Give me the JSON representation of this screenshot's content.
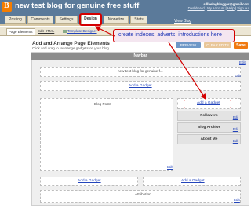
{
  "header": {
    "title": "new test blog for genuine free stuff",
    "email": "sillbeloghlogger@gmail.com",
    "links": [
      "Dashboard",
      "My Account",
      "Help",
      "Sign out"
    ]
  },
  "tabs": [
    {
      "label": "Posting"
    },
    {
      "label": "Comments"
    },
    {
      "label": "Settings"
    },
    {
      "label": "Design"
    },
    {
      "label": "Monetize"
    },
    {
      "label": "Stats"
    }
  ],
  "view_blog": "View Blog",
  "subtabs": {
    "page_elements": "Page Elements",
    "edit_html": "Edit HTML",
    "template_designer": "Template Designer"
  },
  "content": {
    "title": "Add and Arrange Page Elements",
    "subtitle": "Click and drag to rearrange gadgets on your blog.",
    "preview": "PREVIEW",
    "clear": "CLEAR EDITS",
    "save": "Save"
  },
  "layout": {
    "navbar": "Navbar",
    "header_gadget": "new test blog for genuine f...",
    "add_gadget": "Add a Gadget",
    "blog_posts": "Blog Posts",
    "sidebar_add": "Add a Gadget",
    "sidebar_items": [
      "Followers",
      "Blog Archive",
      "About Me"
    ],
    "footer_add_left": "Add a Gadget",
    "footer_add_right": "Add a Gadget",
    "attribution": "Attribution",
    "edit": "Edit"
  },
  "callout": "create indexes, adverts, introductions here",
  "colors": {
    "header_bg": "#5b7a9a",
    "annotation_red": "#d40000",
    "save_orange": "#f07a10"
  }
}
